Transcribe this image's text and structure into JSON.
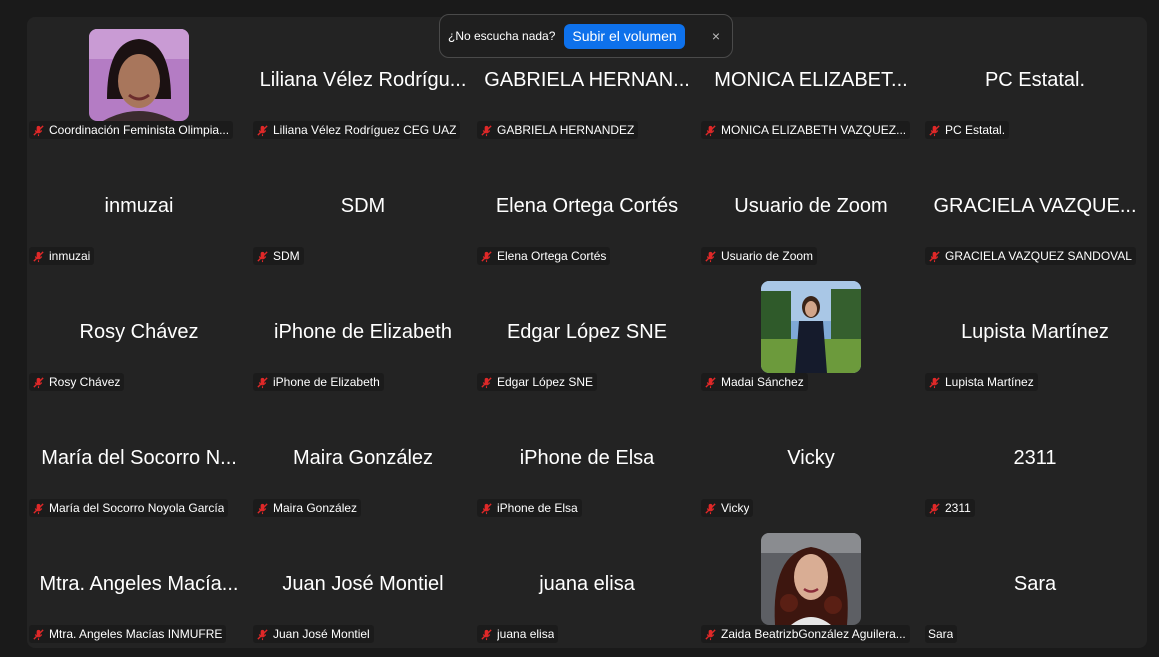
{
  "banner": {
    "text": "¿No escucha nada?",
    "button_label": "Subir el volumen",
    "close_symbol": "×"
  },
  "colors": {
    "stage_background": "#232323",
    "muted_mic_red": "#e02828",
    "button_blue": "#0e71eb"
  },
  "participants": [
    {
      "name": "Coordinación Feminista Olimpia...",
      "label": "Coordinación Feminista Olimpia...",
      "has_photo": true
    },
    {
      "name": "Liliana Vélez Rodrígu...",
      "label": "Liliana Vélez Rodríguez CEG UAZ"
    },
    {
      "name": "GABRIELA HERNAN...",
      "label": "GABRIELA HERNANDEZ"
    },
    {
      "name": "MONICA ELIZABET...",
      "label": "MONICA ELIZABETH VAZQUEZ..."
    },
    {
      "name": "PC Estatal.",
      "label": "PC Estatal."
    },
    {
      "name": "inmuzai",
      "label": "inmuzai"
    },
    {
      "name": "SDM",
      "label": "SDM"
    },
    {
      "name": "Elena Ortega Cortés",
      "label": "Elena Ortega Cortés"
    },
    {
      "name": "Usuario de Zoom",
      "label": "Usuario de Zoom"
    },
    {
      "name": "GRACIELA VAZQUE...",
      "label": "GRACIELA VAZQUEZ SANDOVAL"
    },
    {
      "name": "Rosy Chávez",
      "label": "Rosy Chávez"
    },
    {
      "name": "iPhone de Elizabeth",
      "label": "iPhone de Elizabeth"
    },
    {
      "name": "Edgar López SNE",
      "label": "Edgar López SNE"
    },
    {
      "name": "",
      "label": "Madai Sánchez",
      "has_photo": true
    },
    {
      "name": "Lupista Martínez",
      "label": "Lupista Martínez"
    },
    {
      "name": "María del Socorro N...",
      "label": "María del Socorro Noyola García"
    },
    {
      "name": "Maira González",
      "label": "Maira González"
    },
    {
      "name": "iPhone de Elsa",
      "label": "iPhone de Elsa"
    },
    {
      "name": "Vicky",
      "label": "Vicky"
    },
    {
      "name": "2311",
      "label": "2311"
    },
    {
      "name": "Mtra. Angeles Macía...",
      "label": "Mtra. Angeles Macías INMUFRE"
    },
    {
      "name": "Juan José Montiel",
      "label": "Juan José Montiel"
    },
    {
      "name": "juana elisa",
      "label": "juana elisa"
    },
    {
      "name": "",
      "label": "Zaida BeatrizbGonzález Aguilera...",
      "has_photo": true
    },
    {
      "name": "Sara",
      "label": "Sara",
      "muted": false
    }
  ]
}
